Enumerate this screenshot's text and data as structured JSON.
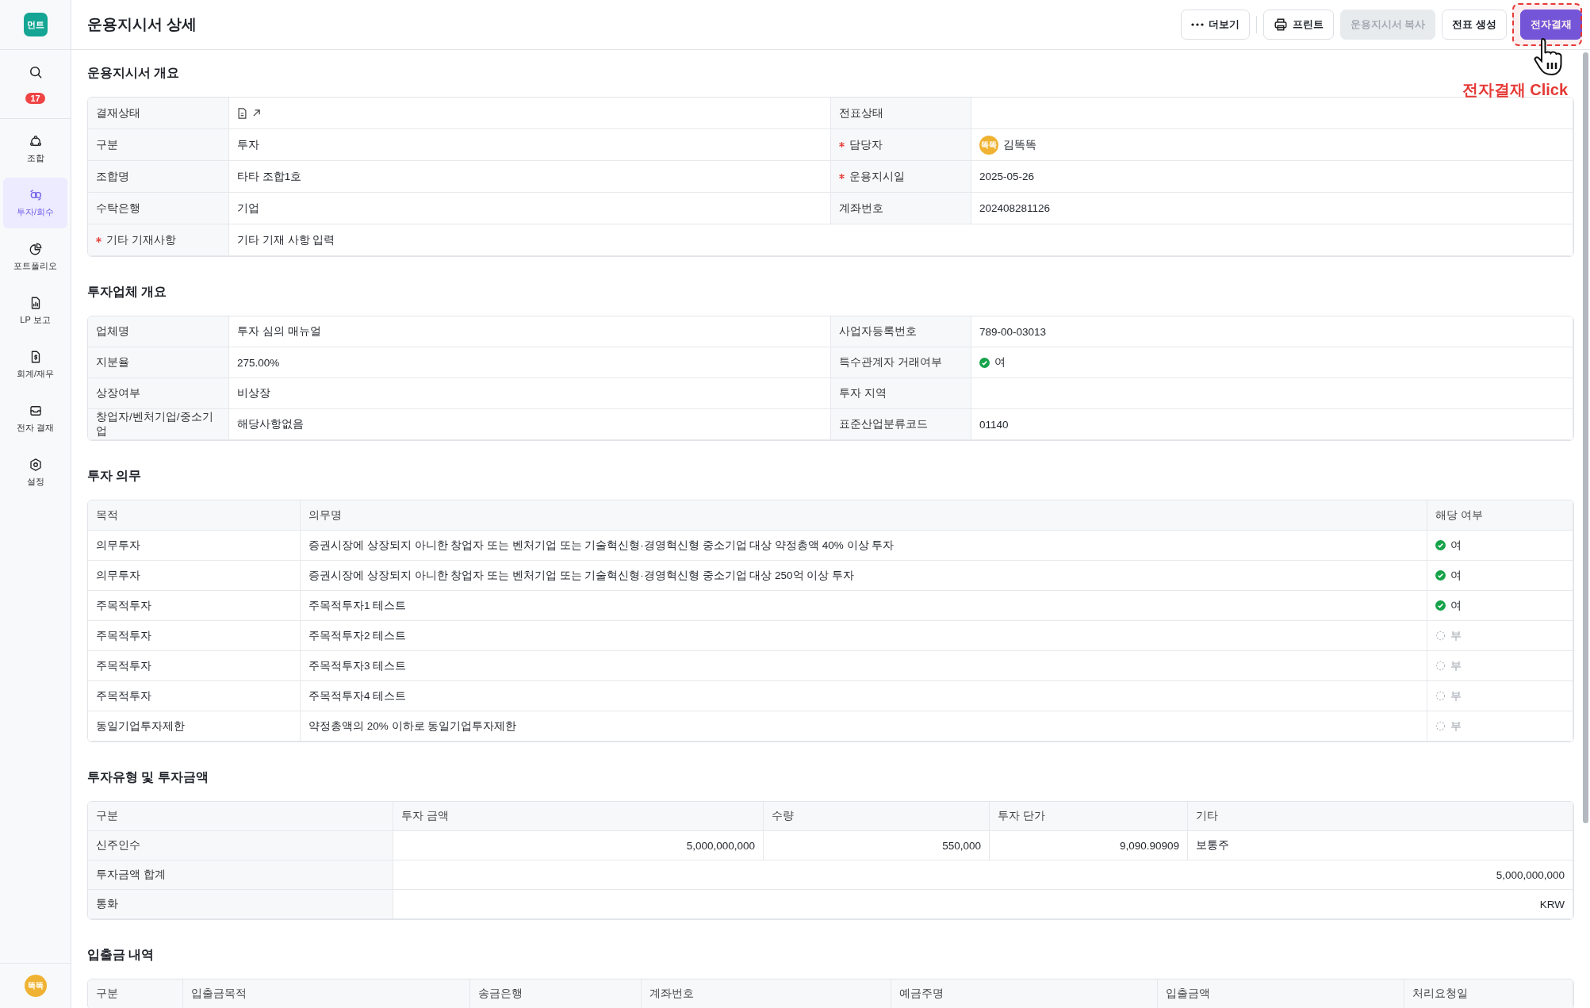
{
  "sidebar": {
    "logo": "먼트",
    "badge": "17",
    "avatar": "똑똑",
    "items": [
      {
        "label": "조합",
        "kind": "fund",
        "selected": false
      },
      {
        "label": "투자/회수",
        "kind": "invest",
        "selected": true
      },
      {
        "label": "포트폴리오",
        "kind": "portfolio",
        "selected": false
      },
      {
        "label": "LP 보고",
        "kind": "report",
        "selected": false
      },
      {
        "label": "회계/재무",
        "kind": "accounting",
        "selected": false
      },
      {
        "label": "전자 결재",
        "kind": "approval",
        "selected": false
      },
      {
        "label": "설정",
        "kind": "settings",
        "selected": false
      }
    ]
  },
  "header": {
    "title": "운용지시서 상세",
    "buttons": [
      {
        "label": "더보기",
        "kind": "more",
        "disabled": false
      },
      {
        "label": "프린트",
        "kind": "print",
        "disabled": false
      },
      {
        "label": "운용지시서 복사",
        "kind": "plain",
        "disabled": true
      },
      {
        "label": "전표 생성",
        "kind": "plain",
        "disabled": false
      },
      {
        "label": "전자결재",
        "kind": "primary",
        "disabled": false
      }
    ]
  },
  "annotation": {
    "text": "전자결재 Click"
  },
  "sections": [
    {
      "title": "운용지시서 개요",
      "kind": "fields",
      "rows": [
        [
          {
            "label": "결재상태",
            "required": false,
            "kind": "doc-link"
          },
          {
            "label": "전표상태",
            "required": false,
            "kind": "text"
          }
        ],
        [
          {
            "label": "구분",
            "required": false,
            "kind": "text",
            "value": "투자"
          },
          {
            "label": "담당자",
            "required": true,
            "kind": "person",
            "avatar": "똑똑",
            "value": "김똑똑"
          }
        ],
        [
          {
            "label": "조합명",
            "required": false,
            "kind": "text",
            "value": "타타 조합1호"
          },
          {
            "label": "운용지시일",
            "required": true,
            "kind": "text",
            "value": "2025-05-26"
          }
        ],
        [
          {
            "label": "수탁은행",
            "required": false,
            "kind": "text",
            "value": "기업"
          },
          {
            "label": "계좌번호",
            "required": false,
            "kind": "text",
            "value": "202408281126"
          }
        ],
        [
          {
            "label": "기타 기재사항",
            "required": true,
            "kind": "text",
            "value": "기타 기재 사항 입력"
          }
        ]
      ]
    },
    {
      "title": "투자업체 개요",
      "kind": "fields",
      "rows": [
        [
          {
            "label": "업체명",
            "required": false,
            "kind": "text",
            "value": "투자 심의 매뉴얼"
          },
          {
            "label": "사업자등록번호",
            "required": false,
            "kind": "text",
            "value": "789-00-03013"
          }
        ],
        [
          {
            "label": "지분율",
            "required": false,
            "kind": "text",
            "value": "275.00%"
          },
          {
            "label": "특수관계자 거래여부",
            "required": false,
            "kind": "status",
            "applicable": true,
            "value": "여"
          }
        ],
        [
          {
            "label": "상장여부",
            "required": false,
            "kind": "text",
            "value": "비상장"
          },
          {
            "label": "투자 지역",
            "required": false,
            "kind": "text"
          }
        ],
        [
          {
            "label": "창업자/벤처기업/중소기업",
            "required": false,
            "kind": "text",
            "value": "해당사항없음"
          },
          {
            "label": "표준산업분류코드",
            "required": false,
            "kind": "text",
            "value": "01140"
          }
        ]
      ]
    },
    {
      "title": "투자 의무",
      "kind": "obligations",
      "columns": [
        "목적",
        "의무명",
        "해당 여부"
      ],
      "rows": [
        {
          "purpose": "의무투자",
          "name": "증권시장에 상장되지 아니한 창업자 또는 벤처기업 또는 기술혁신형·경영혁신형 중소기업 대상 약정총액 40% 이상 투자",
          "applicable": true,
          "status": "여"
        },
        {
          "purpose": "의무투자",
          "name": "증권시장에 상장되지 아니한 창업자 또는 벤처기업 또는 기술혁신형·경영혁신형 중소기업 대상 250억 이상 투자",
          "applicable": true,
          "status": "여"
        },
        {
          "purpose": "주목적투자",
          "name": "주목적투자1 테스트",
          "applicable": true,
          "status": "여"
        },
        {
          "purpose": "주목적투자",
          "name": "주목적투자2 테스트",
          "applicable": false,
          "status": "부"
        },
        {
          "purpose": "주목적투자",
          "name": "주목적투자3 테스트",
          "applicable": false,
          "status": "부"
        },
        {
          "purpose": "주목적투자",
          "name": "주목적투자4 테스트",
          "applicable": false,
          "status": "부"
        },
        {
          "purpose": "동일기업투자제한",
          "name": "약정총액의 20% 이하로 동일기업투자제한",
          "applicable": false,
          "status": "부"
        }
      ]
    },
    {
      "title": "투자유형 및 투자금액",
      "kind": "amounts",
      "columns": [
        "구분",
        "투자 금액",
        "수량",
        "투자 단가",
        "기타"
      ],
      "rows": [
        [
          "신주인수",
          "5,000,000,000",
          "550,000",
          "9,090.90909",
          "보통주"
        ],
        [
          "투자금액 합계",
          "5,000,000,000"
        ],
        [
          "통화",
          "KRW"
        ]
      ]
    },
    {
      "title": "입출금 내역",
      "kind": "cashflow",
      "columns": [
        "구분",
        "입출금목적",
        "송금은행",
        "계좌번호",
        "예금주명",
        "입출금액",
        "처리요청일"
      ]
    }
  ]
}
